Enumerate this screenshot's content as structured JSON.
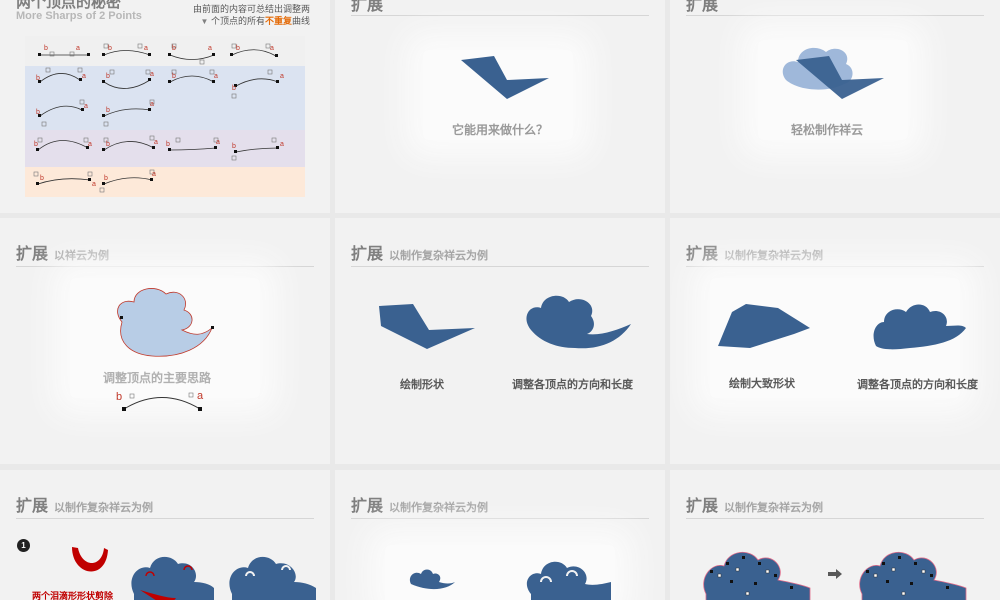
{
  "slides": [
    {
      "id": 1,
      "title": "两个顶点的秘密",
      "subtitle": "More Sharps of 2 Points",
      "note_line1": "由前面的内容可总结出调整两",
      "note_line2_pre": "个顶点的所有",
      "note_highlight": "不重复",
      "note_line2_post": "曲线",
      "point_a": "a",
      "point_b": "b",
      "colors": {
        "highlight": "#e46c0a",
        "band_white": "#f2f2f2",
        "band_blue": "#dbe3f1",
        "band_purple": "#e4dfec",
        "band_orange": "#fde9d9"
      }
    },
    {
      "id": 2,
      "title": "扩展",
      "caption": "它能用来做什么？"
    },
    {
      "id": 3,
      "title": "扩展",
      "caption": "轻松制作祥云"
    },
    {
      "id": 4,
      "title": "扩展",
      "subtitle": "以祥云为例",
      "caption": "调整顶点的主要思路",
      "point_a": "a",
      "point_b": "b"
    },
    {
      "id": 5,
      "title": "扩展",
      "subtitle": "以制作复杂祥云为例",
      "caption_left": "绘制形状",
      "caption_right": "调整各顶点的方向和长度"
    },
    {
      "id": 6,
      "title": "扩展",
      "subtitle": "以制作复杂祥云为例",
      "caption_left": "绘制大致形状",
      "caption_right": "调整各顶点的方向和长度"
    },
    {
      "id": 7,
      "title": "扩展",
      "subtitle": "以制作复杂祥云为例",
      "step_number": "1",
      "caption": "两个泪滴形形状剪除"
    },
    {
      "id": 8,
      "title": "扩展",
      "subtitle": "以制作复杂祥云为例"
    },
    {
      "id": 9,
      "title": "扩展",
      "subtitle": "以制作复杂祥云为例"
    }
  ],
  "colors": {
    "shape_blue": "#3a6190",
    "light_blue": "#9fb8da",
    "outline_red": "#c0392b",
    "title_gray": "#7f7f7f"
  }
}
